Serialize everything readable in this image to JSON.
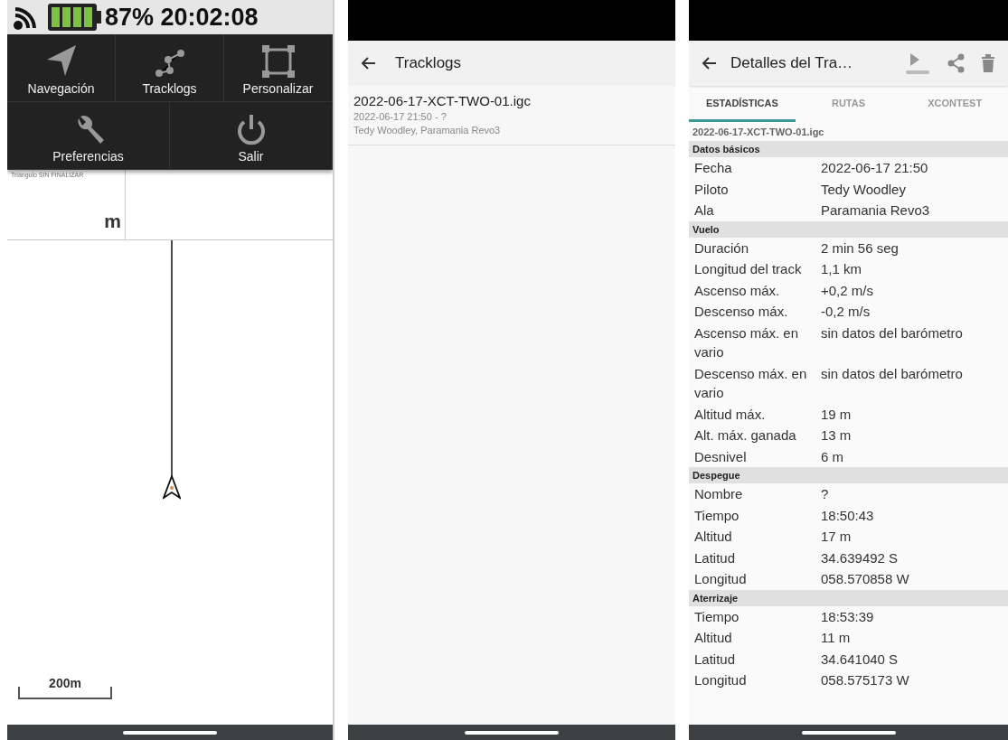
{
  "map_screen": {
    "status_text": "87% 20:02:08",
    "menu": [
      {
        "label": "Navegación",
        "kind": "navigate"
      },
      {
        "label": "Tracklogs",
        "kind": "track"
      },
      {
        "label": "Personalizar",
        "kind": "customize"
      },
      {
        "label": "Preferencias",
        "kind": "preferences"
      },
      {
        "label": "Salir",
        "kind": "exit"
      }
    ],
    "instrument_label": "Triángulo SIN FINALIZAR",
    "instrument_unit": "m",
    "scale": "200m"
  },
  "tracklogs_screen": {
    "title": "Tracklogs",
    "items": [
      {
        "name": "2022-06-17-XCT-TWO-01.igc",
        "date": "2022-06-17 21:50 - ?",
        "details": "Tedy Woodley, Paramania Revo3"
      }
    ]
  },
  "details_screen": {
    "title": "Detalles del Tra…",
    "tabs": [
      {
        "label": "ESTADÍSTICAS",
        "selected": true
      },
      {
        "label": "RUTAS",
        "selected": false
      },
      {
        "label": "XCONTEST",
        "selected": false
      }
    ],
    "file": "2022-06-17-XCT-TWO-01.igc",
    "sections": [
      {
        "title": "Datos básicos",
        "rows": [
          {
            "label": "Fecha",
            "value": "2022-06-17 21:50"
          },
          {
            "label": "Piloto",
            "value": "Tedy Woodley"
          },
          {
            "label": "Ala",
            "value": "Paramania Revo3"
          }
        ]
      },
      {
        "title": "Vuelo",
        "rows": [
          {
            "label": "Duración",
            "value": "2 min 56 seg"
          },
          {
            "label": "Longitud del track",
            "value": "1,1 km"
          },
          {
            "label": "Ascenso máx.",
            "value": "+0,2 m/s"
          },
          {
            "label": "Descenso máx.",
            "value": "-0,2 m/s"
          },
          {
            "label": "Ascenso máx. en vario",
            "value": "sin datos del barómetro"
          },
          {
            "label": "Descenso máx. en vario",
            "value": "sin datos del barómetro"
          },
          {
            "label": "Altitud máx.",
            "value": "19 m"
          },
          {
            "label": "Alt. máx. ganada",
            "value": "13 m"
          },
          {
            "label": "Desnivel",
            "value": "6 m"
          }
        ]
      },
      {
        "title": "Despegue",
        "rows": [
          {
            "label": "Nombre",
            "value": "?"
          },
          {
            "label": "Tiempo",
            "value": "18:50:43"
          },
          {
            "label": "Altitud",
            "value": "17 m"
          },
          {
            "label": "Latitud",
            "value": "34.639492 S"
          },
          {
            "label": "Longitud",
            "value": "058.570858 W"
          }
        ]
      },
      {
        "title": "Aterrizaje",
        "rows": [
          {
            "label": "Tiempo",
            "value": "18:53:39"
          },
          {
            "label": "Altitud",
            "value": "11 m"
          },
          {
            "label": "Latitud",
            "value": "34.641040 S"
          },
          {
            "label": "Longitud",
            "value": "058.575173 W"
          }
        ]
      }
    ]
  }
}
